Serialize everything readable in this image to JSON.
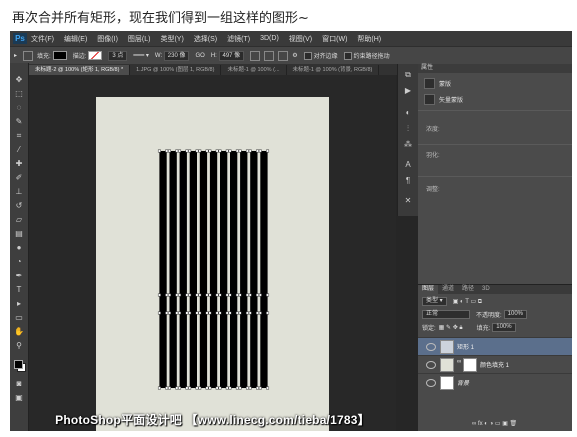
{
  "caption": "再次合并所有矩形，现在我们得到一组这样的图形~",
  "app": {
    "logo": "Ps",
    "menu": [
      "文件(F)",
      "编辑(E)",
      "图像(I)",
      "图层(L)",
      "类型(Y)",
      "选择(S)",
      "滤镜(T)",
      "3D(D)",
      "视图(V)",
      "窗口(W)",
      "帮助(H)"
    ]
  },
  "options": {
    "fill_label": "填充:",
    "stroke_label": "描边:",
    "stroke_size": "3 点",
    "w_label": "W:",
    "w_value": "230 像",
    "link": "GO",
    "h_label": "H:",
    "h_value": "497 像",
    "align_edges": "对齐边缘",
    "constrain_path": "约束路径拖动"
  },
  "tabs": [
    "未标题-2 @ 100% (矩形 1, RGB/8) *",
    "1.JPG @ 100% (图层 1, RGB/8)",
    "未标题-1 @ 100% (...",
    "未标题-1 @ 100% (背景, RGB/8)"
  ],
  "properties": {
    "title": "属性",
    "mask_label": "蒙版",
    "vector_mask_label": "矢量蒙版",
    "density_label": "浓度:",
    "feather_label": "羽化:",
    "refine_label": "调整:"
  },
  "layers_panel": {
    "tabs": [
      "图层",
      "通道",
      "路径",
      "3D"
    ],
    "kind_label": "类型",
    "blend_mode": "正常",
    "opacity_label": "不透明度:",
    "opacity_value": "100%",
    "lock_label": "锁定:",
    "fill_label": "填充:",
    "fill_value": "100%",
    "layers": [
      {
        "name": "矩形 1",
        "selected": true
      },
      {
        "name": "颜色填充 1",
        "selected": false
      },
      {
        "name": "背景",
        "selected": false
      }
    ]
  },
  "canvas": {
    "document_color": "#e0e1d7",
    "shape_color": "#000000",
    "stripe_count": 11
  },
  "watermark": "PhotoShop平面设计吧 【www.linecg.com/tieba/1783】"
}
